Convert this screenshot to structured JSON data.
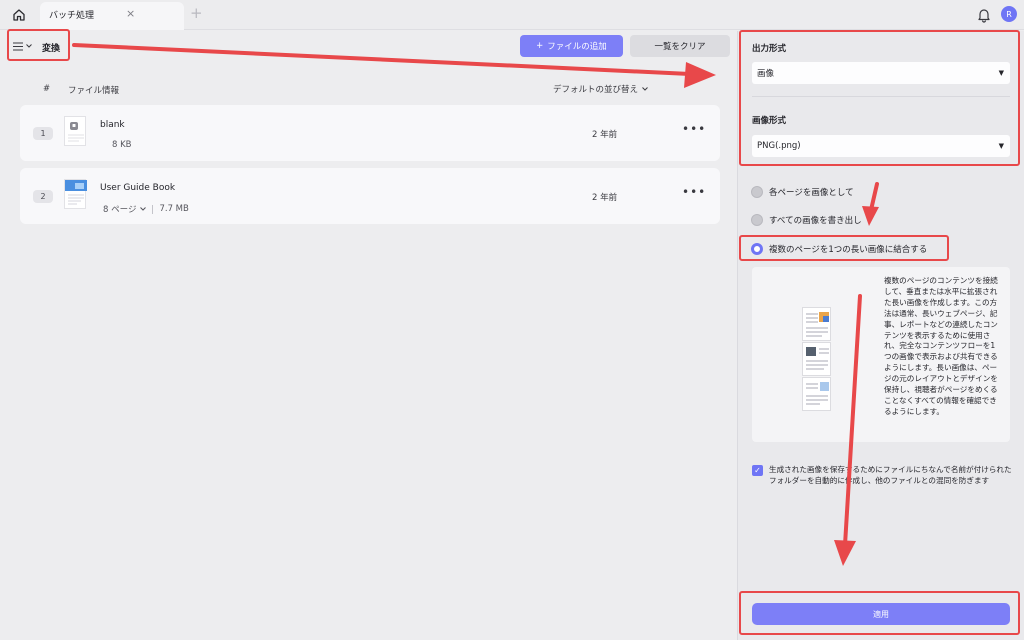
{
  "tabbar": {
    "tab_title": "バッチ処理",
    "close_glyph": "×",
    "add_glyph": "+",
    "avatar_initial": "R"
  },
  "toolbar": {
    "mode_label": "変換",
    "add_file_label": "ファイルの追加",
    "add_file_glyph": "+",
    "clear_list_label": "一覧をクリア"
  },
  "file_list": {
    "col_number": "#",
    "col_file_info": "ファイル情報",
    "sort_label": "デフォルトの並び替え",
    "files": [
      {
        "index": "1",
        "name": "blank",
        "size": "8 KB",
        "time": "2 年前",
        "more": "•••"
      },
      {
        "index": "2",
        "name": "User Guide Book",
        "pages": "8 ページ",
        "size": "7.7 MB",
        "time": "2 年前",
        "more": "•••"
      }
    ]
  },
  "panel": {
    "output_format_label": "出力形式",
    "output_format_value": "画像",
    "image_format_label": "画像形式",
    "image_format_value": "PNG(.png)",
    "options": [
      {
        "label": "各ページを画像として",
        "selected": false
      },
      {
        "label": "すべての画像を書き出し",
        "selected": false
      },
      {
        "label": "複数のページを1つの長い画像に結合する",
        "selected": true
      }
    ],
    "description": "複数のページのコンテンツを接続して、垂直または水平に拡張された長い画像を作成します。この方法は通常、長いウェブページ、記事、レポートなどの連続したコンテンツを表示するために使用され、完全なコンテンツフローを1つの画像で表示および共有できるようにします。長い画像は、ページの元のレイアウトとデザインを保持し、視聴者がページをめくることなくすべての情報を確認できるようにします。",
    "folder_option": "生成された画像を保存するためにファイルにちなんで名前が付けられたフォルダーを自動的に作成し、他のファイルとの混同を防ぎます",
    "folder_option_checked": true,
    "apply_label": "適用"
  },
  "colors": {
    "accent": "#7d7ff7",
    "annotation": "#e8484a"
  }
}
